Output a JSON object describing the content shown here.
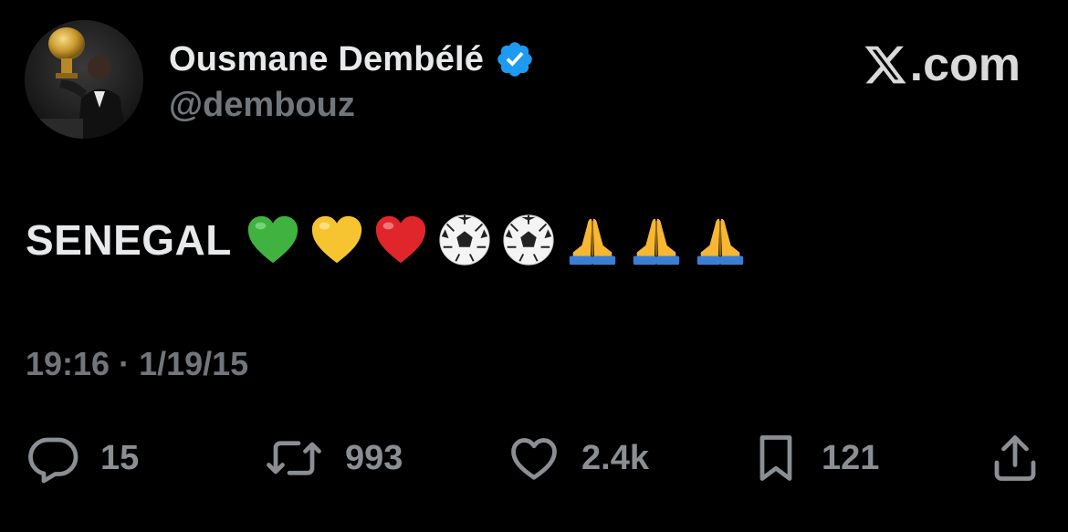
{
  "author": {
    "display_name": "Ousmane Dembélé",
    "handle": "@dembouz",
    "verified": true,
    "avatar": "avatar-photo-trophy"
  },
  "brand": {
    "icon": "x-logo-icon",
    "label": ".com"
  },
  "tweet": {
    "text": "SENEGAL",
    "emojis": [
      "green-heart",
      "yellow-heart",
      "red-heart",
      "soccer-ball",
      "soccer-ball",
      "folded-hands",
      "folded-hands",
      "folded-hands"
    ],
    "timestamp": "19:16 · 1/19/15"
  },
  "actions": {
    "replies": "15",
    "reposts": "993",
    "likes": "2.4k",
    "bookmarks": "121"
  },
  "colors": {
    "background": "#000000",
    "text": "#e7e9ea",
    "muted": "#71767b",
    "verified": "#1d9bf0"
  }
}
